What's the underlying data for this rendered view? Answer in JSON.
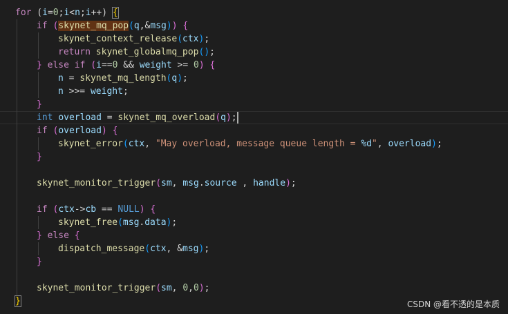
{
  "editor": {
    "lines": [
      {
        "indent": 0,
        "tokens": [
          [
            "for",
            "t-keyword"
          ],
          [
            " (",
            "t-text"
          ],
          [
            "i",
            "t-var"
          ],
          [
            "=",
            "t-text"
          ],
          [
            "0",
            "t-num"
          ],
          [
            ";",
            "t-text"
          ],
          [
            "i",
            "t-var"
          ],
          [
            "<",
            "t-text"
          ],
          [
            "n",
            "t-var"
          ],
          [
            ";",
            "t-text"
          ],
          [
            "i",
            "t-var"
          ],
          [
            "++",
            "t-text"
          ],
          [
            ") ",
            "t-text"
          ],
          [
            "{",
            "t-b1 match"
          ]
        ]
      },
      {
        "indent": 1,
        "tokens": [
          [
            "if",
            "t-keyword"
          ],
          [
            " ",
            "t-text"
          ],
          [
            "(",
            "t-b2"
          ],
          [
            "skynet_mq_pop",
            "t-func hl-word"
          ],
          [
            "(",
            "t-b3"
          ],
          [
            "q",
            "t-var"
          ],
          [
            ",&",
            "t-text"
          ],
          [
            "msg",
            "t-var"
          ],
          [
            ")",
            "t-b3"
          ],
          [
            ")",
            "t-b2"
          ],
          [
            " ",
            "t-text"
          ],
          [
            "{",
            "t-b2"
          ]
        ]
      },
      {
        "indent": 2,
        "tokens": [
          [
            "skynet_context_release",
            "t-func"
          ],
          [
            "(",
            "t-b3"
          ],
          [
            "ctx",
            "t-var"
          ],
          [
            ")",
            "t-b3"
          ],
          [
            ";",
            "t-text"
          ]
        ]
      },
      {
        "indent": 2,
        "tokens": [
          [
            "return",
            "t-keyword"
          ],
          [
            " ",
            "t-text"
          ],
          [
            "skynet_globalmq_pop",
            "t-func"
          ],
          [
            "(",
            "t-b3"
          ],
          [
            ")",
            "t-b3"
          ],
          [
            ";",
            "t-text"
          ]
        ]
      },
      {
        "indent": 1,
        "tokens": [
          [
            "}",
            "t-b2"
          ],
          [
            " ",
            "t-text"
          ],
          [
            "else",
            "t-keyword"
          ],
          [
            " ",
            "t-text"
          ],
          [
            "if",
            "t-keyword"
          ],
          [
            " ",
            "t-text"
          ],
          [
            "(",
            "t-b2"
          ],
          [
            "i",
            "t-var"
          ],
          [
            "==",
            "t-text"
          ],
          [
            "0",
            "t-num"
          ],
          [
            " && ",
            "t-text"
          ],
          [
            "weight",
            "t-var"
          ],
          [
            " >= ",
            "t-text"
          ],
          [
            "0",
            "t-num"
          ],
          [
            ")",
            "t-b2"
          ],
          [
            " ",
            "t-text"
          ],
          [
            "{",
            "t-b2"
          ]
        ]
      },
      {
        "indent": 2,
        "tokens": [
          [
            "n",
            "t-var"
          ],
          [
            " = ",
            "t-text"
          ],
          [
            "skynet_mq_length",
            "t-func"
          ],
          [
            "(",
            "t-b3"
          ],
          [
            "q",
            "t-var"
          ],
          [
            ")",
            "t-b3"
          ],
          [
            ";",
            "t-text"
          ]
        ]
      },
      {
        "indent": 2,
        "tokens": [
          [
            "n",
            "t-var"
          ],
          [
            " >>= ",
            "t-text"
          ],
          [
            "weight",
            "t-var"
          ],
          [
            ";",
            "t-text"
          ]
        ]
      },
      {
        "indent": 1,
        "tokens": [
          [
            "}",
            "t-b2"
          ]
        ]
      },
      {
        "indent": 1,
        "current": true,
        "tokens": [
          [
            "int",
            "t-type"
          ],
          [
            " ",
            "t-text"
          ],
          [
            "overload",
            "t-var"
          ],
          [
            " = ",
            "t-text"
          ],
          [
            "skynet_mq_overload",
            "t-func"
          ],
          [
            "(",
            "t-b2"
          ],
          [
            "q",
            "t-var"
          ],
          [
            ")",
            "t-b2"
          ],
          [
            ";",
            "t-text"
          ]
        ]
      },
      {
        "indent": 1,
        "tokens": [
          [
            "if",
            "t-keyword"
          ],
          [
            " ",
            "t-text"
          ],
          [
            "(",
            "t-b2"
          ],
          [
            "overload",
            "t-var"
          ],
          [
            ")",
            "t-b2"
          ],
          [
            " ",
            "t-text"
          ],
          [
            "{",
            "t-b2"
          ]
        ]
      },
      {
        "indent": 2,
        "tokens": [
          [
            "skynet_error",
            "t-func"
          ],
          [
            "(",
            "t-b3"
          ],
          [
            "ctx",
            "t-var"
          ],
          [
            ", ",
            "t-text"
          ],
          [
            "\"May overload, message queue length = ",
            "t-str"
          ],
          [
            "%d",
            "t-fmt"
          ],
          [
            "\"",
            "t-str"
          ],
          [
            ", ",
            "t-text"
          ],
          [
            "overload",
            "t-var"
          ],
          [
            ")",
            "t-b3"
          ],
          [
            ";",
            "t-text"
          ]
        ]
      },
      {
        "indent": 1,
        "tokens": [
          [
            "}",
            "t-b2"
          ]
        ]
      },
      {
        "indent": 1,
        "tokens": []
      },
      {
        "indent": 1,
        "tokens": [
          [
            "skynet_monitor_trigger",
            "t-func"
          ],
          [
            "(",
            "t-b2"
          ],
          [
            "sm",
            "t-var"
          ],
          [
            ", ",
            "t-text"
          ],
          [
            "msg",
            "t-var"
          ],
          [
            ".",
            "t-text"
          ],
          [
            "source",
            "t-var"
          ],
          [
            " , ",
            "t-text"
          ],
          [
            "handle",
            "t-var"
          ],
          [
            ")",
            "t-b2"
          ],
          [
            ";",
            "t-text"
          ]
        ]
      },
      {
        "indent": 1,
        "tokens": []
      },
      {
        "indent": 1,
        "tokens": [
          [
            "if",
            "t-keyword"
          ],
          [
            " ",
            "t-text"
          ],
          [
            "(",
            "t-b2"
          ],
          [
            "ctx",
            "t-var"
          ],
          [
            "->",
            "t-text"
          ],
          [
            "cb",
            "t-var"
          ],
          [
            " == ",
            "t-text"
          ],
          [
            "NULL",
            "t-type"
          ],
          [
            ")",
            "t-b2"
          ],
          [
            " ",
            "t-text"
          ],
          [
            "{",
            "t-b2"
          ]
        ]
      },
      {
        "indent": 2,
        "tokens": [
          [
            "skynet_free",
            "t-func"
          ],
          [
            "(",
            "t-b3"
          ],
          [
            "msg",
            "t-var"
          ],
          [
            ".",
            "t-text"
          ],
          [
            "data",
            "t-var"
          ],
          [
            ")",
            "t-b3"
          ],
          [
            ";",
            "t-text"
          ]
        ]
      },
      {
        "indent": 1,
        "tokens": [
          [
            "}",
            "t-b2"
          ],
          [
            " ",
            "t-text"
          ],
          [
            "else",
            "t-keyword"
          ],
          [
            " ",
            "t-text"
          ],
          [
            "{",
            "t-b2"
          ]
        ]
      },
      {
        "indent": 2,
        "tokens": [
          [
            "dispatch_message",
            "t-func"
          ],
          [
            "(",
            "t-b3"
          ],
          [
            "ctx",
            "t-var"
          ],
          [
            ", &",
            "t-text"
          ],
          [
            "msg",
            "t-var"
          ],
          [
            ")",
            "t-b3"
          ],
          [
            ";",
            "t-text"
          ]
        ]
      },
      {
        "indent": 1,
        "tokens": [
          [
            "}",
            "t-b2"
          ]
        ]
      },
      {
        "indent": 1,
        "tokens": []
      },
      {
        "indent": 1,
        "tokens": [
          [
            "skynet_monitor_trigger",
            "t-func"
          ],
          [
            "(",
            "t-b2"
          ],
          [
            "sm",
            "t-var"
          ],
          [
            ", ",
            "t-text"
          ],
          [
            "0",
            "t-num"
          ],
          [
            ",",
            "t-text"
          ],
          [
            "0",
            "t-num"
          ],
          [
            ")",
            "t-b2"
          ],
          [
            ";",
            "t-text"
          ]
        ]
      },
      {
        "indent": 0,
        "tokens": [
          [
            "}",
            "t-b1 match"
          ]
        ]
      }
    ]
  },
  "watermark": "CSDN @看不透的是本质",
  "colors": {
    "background": "#1e1e1e",
    "keyword": "#c586c0",
    "function": "#dcdcaa",
    "variable": "#9cdcfe",
    "string": "#ce9178",
    "number": "#b5cea8",
    "type": "#569cd6"
  }
}
